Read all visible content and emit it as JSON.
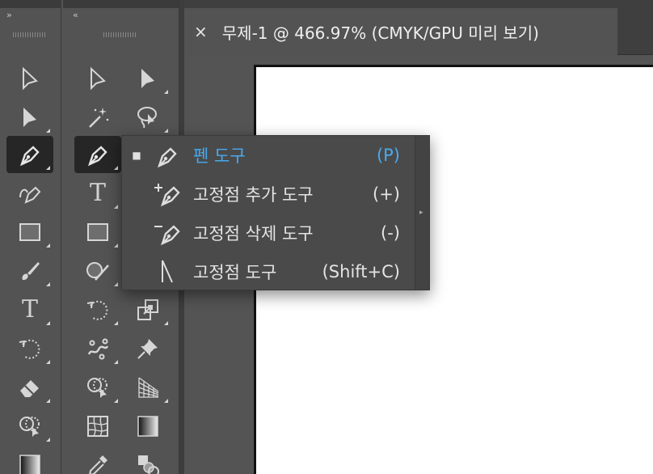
{
  "panels": {
    "left": {
      "collapse_glyph": "»"
    },
    "right": {
      "collapse_glyph": "«"
    }
  },
  "tab": {
    "close_glyph": "×",
    "title": "무제-1 @ 466.97% (CMYK/GPU 미리 보기)"
  },
  "tools_left": [
    {
      "name": "direct-selection-tool",
      "icon": "hollow-arrow-icon"
    },
    {
      "name": "selection-tool",
      "icon": "solid-arrow-icon"
    },
    {
      "name": "pen-tool",
      "icon": "pen-icon",
      "active": true
    },
    {
      "name": "curvature-tool",
      "icon": "curvature-pen-icon"
    },
    {
      "name": "rectangle-tool",
      "icon": "rectangle-icon"
    },
    {
      "name": "paintbrush-tool",
      "icon": "paintbrush-icon"
    },
    {
      "name": "type-tool",
      "icon": "type-icon",
      "glyph": "T"
    },
    {
      "name": "rotate-tool",
      "icon": "rotate-icon"
    },
    {
      "name": "eraser-tool",
      "icon": "eraser-icon"
    },
    {
      "name": "shape-builder-tool",
      "icon": "shape-builder-icon"
    },
    {
      "name": "gradient-tool",
      "icon": "gradient-icon"
    }
  ],
  "tools_right": [
    {
      "name": "direct-selection-tool",
      "icon": "hollow-arrow-icon"
    },
    {
      "name": "selection-tool",
      "icon": "solid-arrow-icon"
    },
    {
      "name": "magic-wand-tool",
      "icon": "magic-wand-icon"
    },
    {
      "name": "lasso-tool",
      "icon": "lasso-icon"
    },
    {
      "name": "pen-tool",
      "icon": "pen-icon",
      "active": true
    },
    {
      "name": "type-tool",
      "icon": "type-icon",
      "glyph": "T"
    },
    {
      "name": "rectangle-tool",
      "icon": "rectangle-icon"
    },
    {
      "name": "shaper-tool",
      "icon": "shaper-icon"
    },
    {
      "name": "rotate-tool",
      "icon": "rotate-icon"
    },
    {
      "name": "scale-tool",
      "icon": "scale-icon"
    },
    {
      "name": "puppet-warp-tool",
      "icon": "puppet-warp-icon"
    },
    {
      "name": "pin-tool",
      "icon": "pin-icon"
    },
    {
      "name": "shape-builder-tool",
      "icon": "shape-builder-icon"
    },
    {
      "name": "perspective-grid-tool",
      "icon": "perspective-grid-icon"
    },
    {
      "name": "mesh-tool",
      "icon": "mesh-icon"
    },
    {
      "name": "gradient-tool",
      "icon": "gradient-icon"
    },
    {
      "name": "eyedropper-tool",
      "icon": "eyedropper-icon"
    },
    {
      "name": "blend-tool",
      "icon": "blend-icon"
    }
  ],
  "flyout": {
    "items": [
      {
        "label": "펜 도구",
        "shortcut": "(P)",
        "selected": true,
        "check": "■",
        "icon": "pen-icon"
      },
      {
        "label": "고정점 추가 도구",
        "shortcut": "(+)",
        "selected": false,
        "icon": "add-anchor-point-icon"
      },
      {
        "label": "고정점 삭제 도구",
        "shortcut": "(-)",
        "selected": false,
        "icon": "delete-anchor-point-icon"
      },
      {
        "label": "고정점 도구",
        "shortcut": "(Shift+C)",
        "selected": false,
        "icon": "anchor-point-icon"
      }
    ],
    "expander_glyph": "▸"
  },
  "colors": {
    "accent": "#49a9ef",
    "panel": "#535353",
    "active_tool": "#262626",
    "menu_bg": "#4a4a4a",
    "artboard": "#ffffff"
  }
}
